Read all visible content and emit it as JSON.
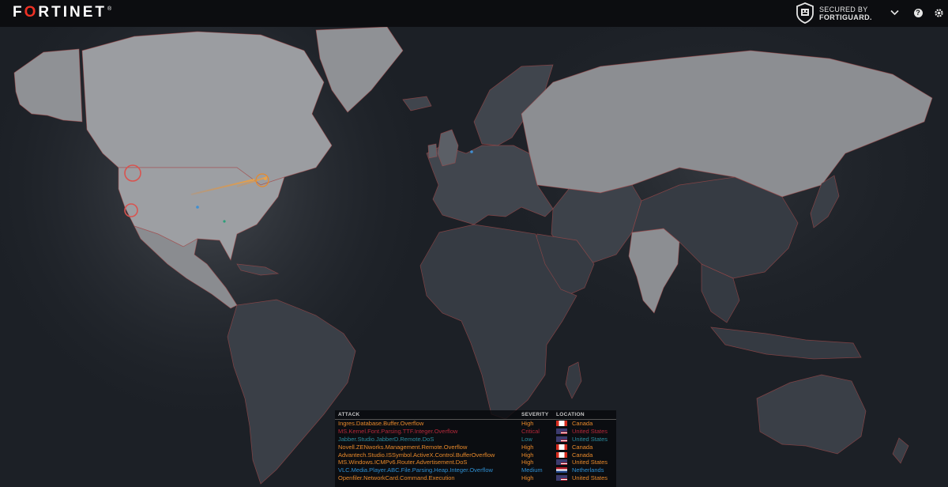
{
  "header": {
    "brand": "FORTINET",
    "secured_line1": "SECURED BY",
    "secured_line2": "FORTIGUARD."
  },
  "icons": {
    "shield": "fortiguard-shield-icon",
    "menu": "chevron-down-icon",
    "help": "help-icon",
    "settings": "gear-icon"
  },
  "colors": {
    "accent": "#ee3124",
    "high": "#e8892a",
    "critical": "#b6283a",
    "low": "#2b8d9f",
    "medium": "#2e8fd2"
  },
  "feed": {
    "columns": {
      "attack": "ATTACK",
      "severity": "SEVERITY",
      "location": "LOCATION"
    },
    "rows": [
      {
        "attack": "Ingres.Database.Buffer.Overflow",
        "severity": "High",
        "location": "Canada",
        "flag": "canada"
      },
      {
        "attack": "MS.Kernel.Font.Parsing.TTF.Integer.Overflow",
        "severity": "Critical",
        "location": "United States",
        "flag": "usa"
      },
      {
        "attack": "Jabber.Studio.JabberD.Remote.DoS",
        "severity": "Low",
        "location": "United States",
        "flag": "usa"
      },
      {
        "attack": "Novell.ZENworks.Management.Remote.Overflow",
        "severity": "High",
        "location": "Canada",
        "flag": "canada"
      },
      {
        "attack": "Advantech.Studio.ISSymbol.ActiveX.Control.BufferOverflow",
        "severity": "High",
        "location": "Canada",
        "flag": "canada"
      },
      {
        "attack": "MS.Windows.ICMPv6.Router.Advertisement.DoS",
        "severity": "High",
        "location": "United States",
        "flag": "usa"
      },
      {
        "attack": "VLC.Media.Player.ABC.File.Parsing.Heap.Integer.Overflow",
        "severity": "Medium",
        "location": "Netherlands",
        "flag": "netherlands"
      },
      {
        "attack": "Openfiler.NetworkCard.Command.Execution",
        "severity": "High",
        "location": "United States",
        "flag": "usa"
      }
    ]
  }
}
